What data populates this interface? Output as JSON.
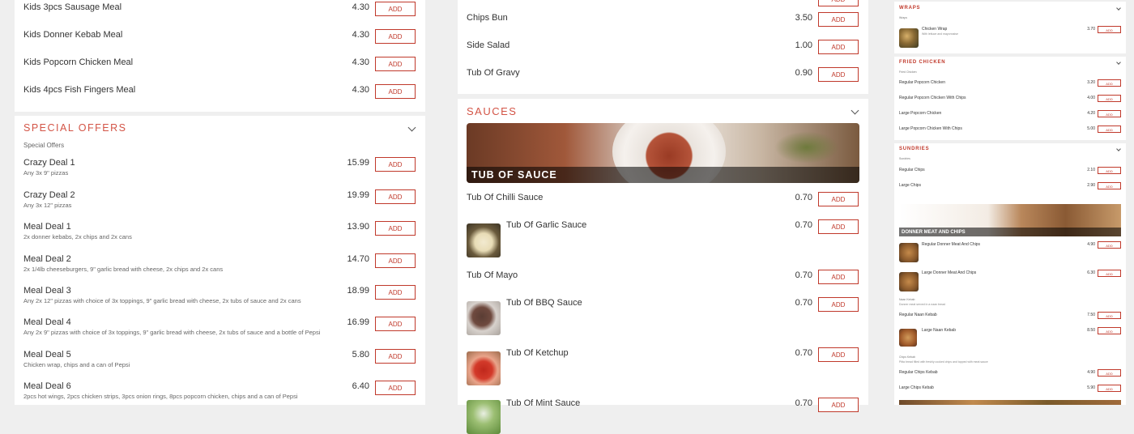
{
  "left": {
    "kids_items": [
      {
        "name": "Kids 3pcs Sausage Meal",
        "price": "4.30"
      },
      {
        "name": "Kids Donner Kebab Meal",
        "price": "4.30"
      },
      {
        "name": "Kids Popcorn Chicken Meal",
        "price": "4.30"
      },
      {
        "name": "Kids 4pcs Fish Fingers Meal",
        "price": "4.30"
      }
    ],
    "special": {
      "title": "SPECIAL OFFERS",
      "subtitle": "Special Offers",
      "items": [
        {
          "name": "Crazy Deal 1",
          "desc": "Any 3x 9\" pizzas",
          "price": "15.99"
        },
        {
          "name": "Crazy Deal 2",
          "desc": "Any 3x 12\" pizzas",
          "price": "19.99"
        },
        {
          "name": "Meal Deal 1",
          "desc": "2x donner kebabs, 2x chips and 2x cans",
          "price": "13.90"
        },
        {
          "name": "Meal Deal 2",
          "desc": "2x 1/4lb cheeseburgers, 9\" garlic bread with cheese, 2x chips and 2x cans",
          "price": "14.70"
        },
        {
          "name": "Meal Deal 3",
          "desc": "Any 2x 12\" pizzas with choice of 3x toppings, 9\" garlic bread with cheese, 2x tubs of sauce and 2x cans",
          "price": "18.99"
        },
        {
          "name": "Meal Deal 4",
          "desc": "Any 2x 9\" pizzas with choice of 3x toppings, 9\" garlic bread with cheese, 2x tubs of sauce and a bottle of Pepsi",
          "price": "16.99"
        },
        {
          "name": "Meal Deal 5",
          "desc": "Chicken wrap, chips and a can of Pepsi",
          "price": "5.80"
        },
        {
          "name": "Meal Deal 6",
          "desc": "2pcs hot wings, 2pcs chicken strips, 3pcs onion rings, 8pcs popcorn chicken, chips and a can of Pepsi",
          "price": "6.40"
        }
      ]
    }
  },
  "add_label": "ADD",
  "middle": {
    "top_items": [
      {
        "name": "Chips Bun",
        "price": "3.50"
      },
      {
        "name": "Side Salad",
        "price": "1.00"
      },
      {
        "name": "Tub Of Gravy",
        "price": "0.90"
      }
    ],
    "sauces": {
      "title": "SAUCES",
      "banner": "TUB OF SAUCE",
      "items": [
        {
          "name": "Tub Of Chilli Sauce",
          "price": "0.70",
          "icon": "none"
        },
        {
          "name": "Tub Of Garlic Sauce",
          "price": "0.70",
          "icon": "garlic-sauce-photo"
        },
        {
          "name": "Tub Of Mayo",
          "price": "0.70",
          "icon": "none"
        },
        {
          "name": "Tub Of BBQ Sauce",
          "price": "0.70",
          "icon": "bbq-sauce-photo"
        },
        {
          "name": "Tub Of Ketchup",
          "price": "0.70",
          "icon": "ketchup-photo"
        },
        {
          "name": "Tub Of Mint Sauce",
          "price": "0.70",
          "icon": "mint-sauce-photo"
        }
      ]
    }
  },
  "right": {
    "wraps": {
      "title": "WRAPS",
      "sub": "Wraps",
      "items": [
        {
          "name": "Chicken Wrap",
          "desc": "With lettuce and mayonnaise",
          "price": "3.70"
        }
      ]
    },
    "fried": {
      "title": "FRIED CHICKEN",
      "sub": "Fried Chicken",
      "items": [
        {
          "name": "Regular Popcorn Chicken",
          "price": "3.20"
        },
        {
          "name": "Regular Popcorn Chicken With Chips",
          "price": "4.00"
        },
        {
          "name": "Large Popcorn Chicken",
          "price": "4.20"
        },
        {
          "name": "Large Popcorn Chicken With Chips",
          "price": "5.00"
        }
      ]
    },
    "sundries": {
      "title": "SUNDRIES",
      "sub": "Sundries",
      "items": [
        {
          "name": "Regular Chips",
          "price": "2.10"
        },
        {
          "name": "Large Chips",
          "price": "2.90"
        }
      ]
    },
    "donner": {
      "banner": "DONNER MEAT AND CHIPS",
      "items": [
        {
          "name": "Regular Donner Meat And Chips",
          "price": "4.90"
        },
        {
          "name": "Large Donner Meat And Chips",
          "price": "6.30"
        }
      ]
    },
    "naan": {
      "sub": "Naan Kebab",
      "desc": "Donner meat served in a naan bread",
      "items": [
        {
          "name": "Regular Naan Kebab",
          "price": "7.50"
        },
        {
          "name": "Large Naan Kebab",
          "price": "8.50"
        }
      ]
    },
    "chips_kebab": {
      "sub": "Chips Kebab",
      "desc": "Pitta bread filled with freshly cooked chips and topped with meat sauce",
      "items": [
        {
          "name": "Regular Chips Kebab",
          "price": "4.90"
        },
        {
          "name": "Large Chips Kebab",
          "price": "5.90"
        }
      ]
    }
  }
}
